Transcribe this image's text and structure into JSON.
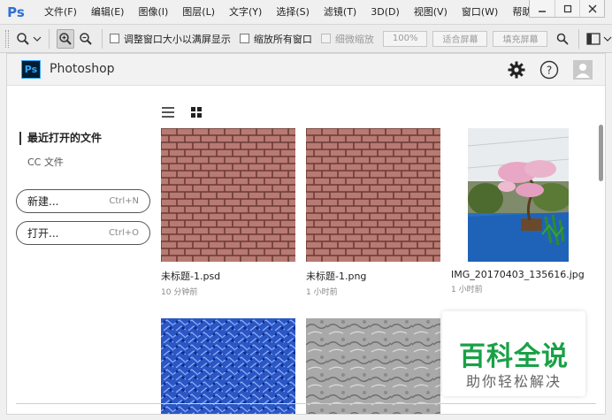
{
  "app_icon": "Ps",
  "menu": [
    "文件(F)",
    "编辑(E)",
    "图像(I)",
    "图层(L)",
    "文字(Y)",
    "选择(S)",
    "滤镜(T)",
    "3D(D)",
    "视图(V)",
    "窗口(W)",
    "帮助(H)"
  ],
  "window_controls": [
    "minimize-icon",
    "restore-icon",
    "close-icon"
  ],
  "options": {
    "resize_windows": "调整窗口大小以满屏显示",
    "zoom_all": "缩放所有窗口",
    "scrubby_zoom": "细微缩放",
    "zoom_percent": "100%",
    "fit_screen": "适合屏幕",
    "fill_screen": "填充屏幕"
  },
  "header": {
    "logo": "Ps",
    "app_name": "Photoshop"
  },
  "sidebar": {
    "recent_label": "最近打开的文件",
    "cc_label": "CC 文件",
    "new_button": {
      "label": "新建...",
      "shortcut": "Ctrl+N"
    },
    "open_button": {
      "label": "打开...",
      "shortcut": "Ctrl+O"
    }
  },
  "files": [
    {
      "name": "未标题-1.psd",
      "time": "10 分钟前"
    },
    {
      "name": "未标题-1.png",
      "time": "1 小时前"
    },
    {
      "name": "IMG_20170403_135616.jpg",
      "time": "1 小时前"
    }
  ],
  "watermark": {
    "main": "百科全说",
    "sub": "助你轻松解决"
  },
  "colors": {
    "ps_blue": "#31a8ff",
    "ps_dark": "#001d34",
    "watermark_green": "#19a146"
  }
}
